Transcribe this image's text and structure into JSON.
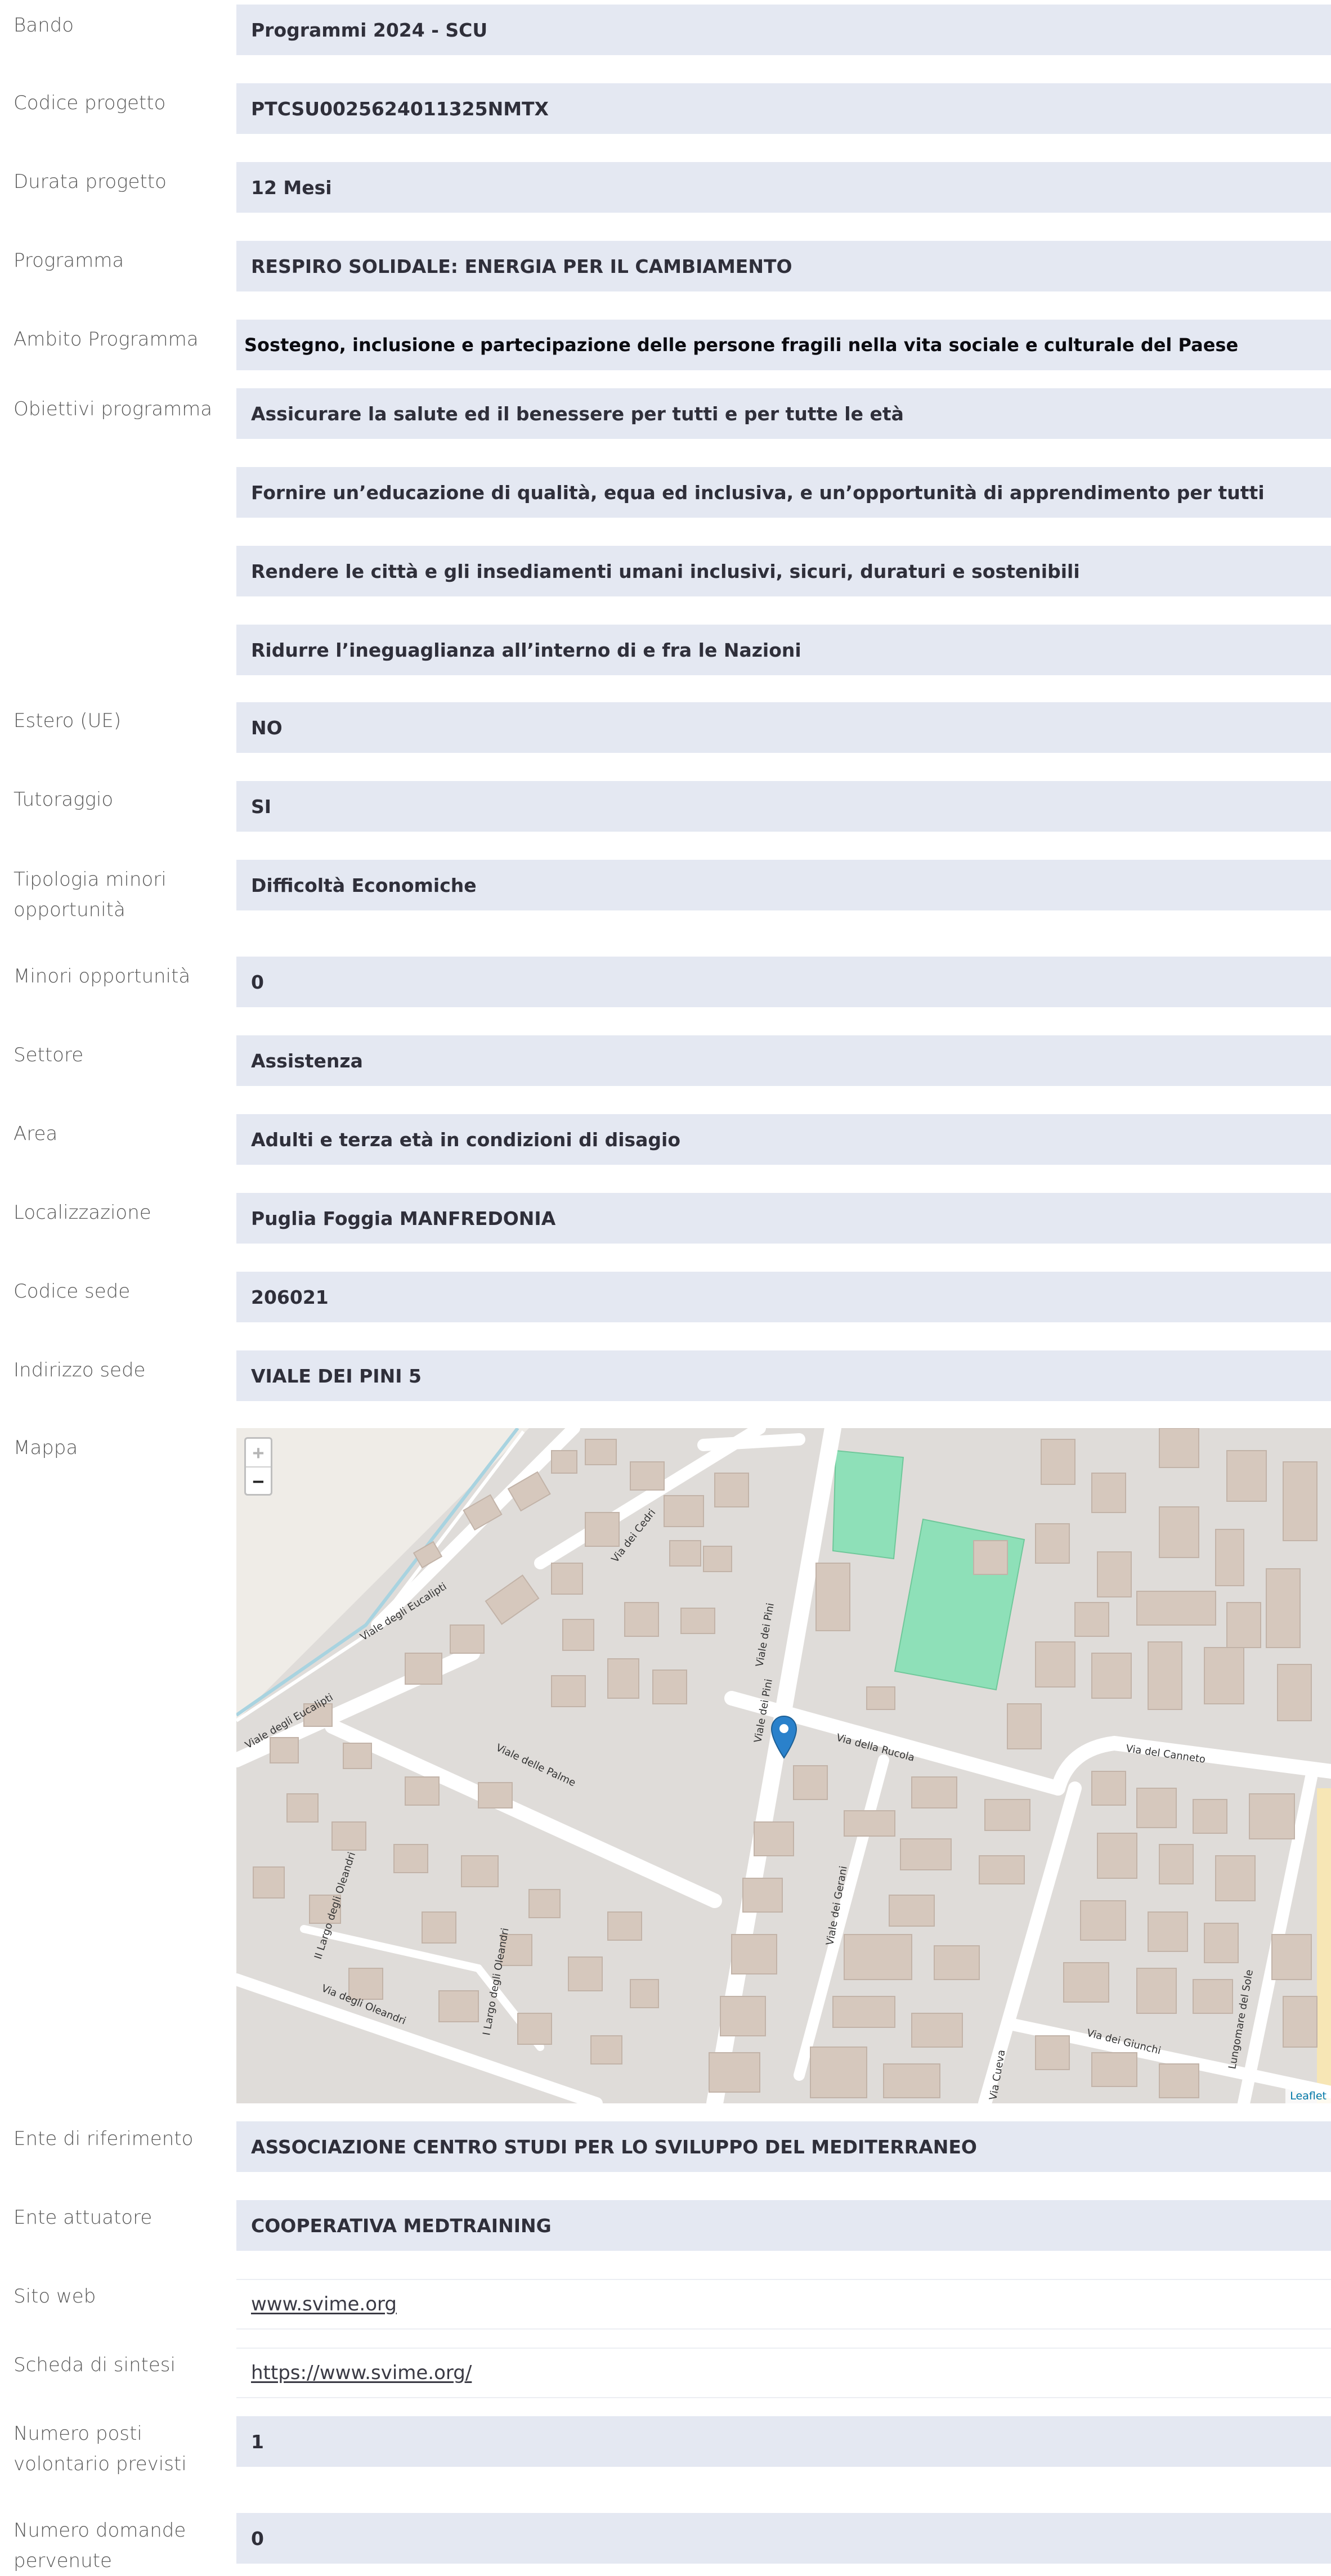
{
  "fields": [
    {
      "label": "Bando",
      "value": "Programmi 2024 - SCU"
    },
    {
      "label": "Codice progetto",
      "value": "PTCSU0025624011325NMTX"
    },
    {
      "label": "Durata progetto",
      "value": "12 Mesi"
    },
    {
      "label": "Programma",
      "value": "RESPIRO SOLIDALE: ENERGIA PER IL CAMBIAMENTO"
    },
    {
      "label": "Ambito Programma",
      "value": "Sostegno, inclusione e partecipazione delle persone fragili nella vita sociale e culturale del Paese"
    },
    {
      "label": "Obiettivi programma",
      "values": [
        "Assicurare la salute ed il benessere per tutti e per tutte le età",
        "Fornire un’educazione di qualità, equa ed inclusiva, e un’opportunità di apprendimento per tutti",
        "Rendere le città e gli insediamenti umani inclusivi, sicuri, duraturi e sostenibili",
        "Ridurre l’ineguaglianza all’interno di e fra le Nazioni"
      ]
    },
    {
      "label": "Estero (UE)",
      "value": "NO"
    },
    {
      "label": "Tutoraggio",
      "value": "SI"
    },
    {
      "label": "Tipologia minori opportunità",
      "value": "Difficoltà Economiche"
    },
    {
      "label": "Minori opportunità",
      "value": "0"
    },
    {
      "label": "Settore",
      "value": "Assistenza"
    },
    {
      "label": "Area",
      "value": "Adulti e terza età in condizioni di disagio"
    },
    {
      "label": "Localizzazione",
      "value": "Puglia Foggia MANFREDONIA"
    },
    {
      "label": "Codice sede",
      "value": "206021"
    },
    {
      "label": "Indirizzo sede",
      "value": "VIALE DEI PINI 5"
    },
    {
      "label": "Mappa"
    },
    {
      "label": "Ente di riferimento",
      "value": "ASSOCIAZIONE CENTRO STUDI PER LO SVILUPPO DEL MEDITERRANEO"
    },
    {
      "label": "Ente attuatore",
      "value": "COOPERATIVA MEDTRAINING"
    },
    {
      "label": "Sito web",
      "value": "www.svime.org"
    },
    {
      "label": "Scheda di sintesi",
      "value": "https://www.svime.org/"
    },
    {
      "label": "Numero posti volontario previsti",
      "value": "1"
    },
    {
      "label": "Numero domande pervenute",
      "value": "0"
    }
  ],
  "map": {
    "zoom_in": "+",
    "zoom_out": "−",
    "attribution": "Leaflet",
    "marker_color": "#2a81cb",
    "street_labels": [
      "Via dei Cedri",
      "Viale degli Eucalipti",
      "Viale degli Eucalipti",
      "Viale dei Pini",
      "Viale dei Pini",
      "Via della Rucola",
      "Via del Canneto",
      "Viale delle Palme",
      "II Largo degli Oleandri",
      "I Largo degli Oleandri",
      "Via degli Oleandri",
      "Viale dei Gerani",
      "Via dei Giunchi",
      "Lungomare del Sole",
      "Via Cueva"
    ]
  }
}
